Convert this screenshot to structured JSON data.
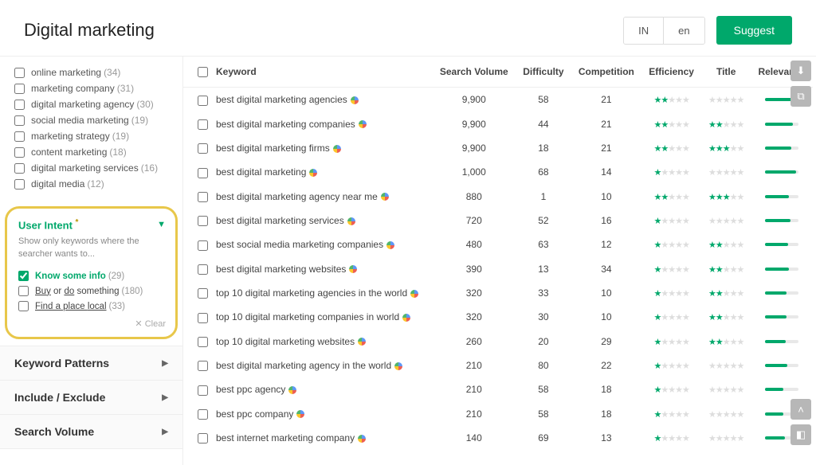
{
  "header": {
    "title": "Digital marketing",
    "country": "IN",
    "lang": "en",
    "suggest": "Suggest"
  },
  "sidebar": {
    "filters": [
      {
        "label": "online marketing",
        "count": 34
      },
      {
        "label": "marketing company",
        "count": 31
      },
      {
        "label": "digital marketing agency",
        "count": 30
      },
      {
        "label": "social media marketing",
        "count": 19
      },
      {
        "label": "marketing strategy",
        "count": 19
      },
      {
        "label": "content marketing",
        "count": 18
      },
      {
        "label": "digital marketing services",
        "count": 16
      },
      {
        "label": "digital media",
        "count": 12
      }
    ],
    "intent": {
      "title": "User Intent",
      "description": "Show only keywords where the searcher wants to...",
      "options": [
        {
          "label": "Know some info",
          "count": 29,
          "checked": true,
          "highlight": true
        },
        {
          "label_pre": "Buy",
          "label_mid": " or ",
          "label_u": "do",
          "label_post": " something",
          "count": 180,
          "checked": false
        },
        {
          "label_pre": "Find a place ",
          "label_u": "local",
          "count": 33,
          "checked": false
        }
      ],
      "clear": "Clear"
    },
    "accordions": [
      "Keyword Patterns",
      "Include / Exclude",
      "Search Volume"
    ]
  },
  "table": {
    "headers": {
      "keyword": "Keyword",
      "volume": "Search Volume",
      "difficulty": "Difficulty",
      "competition": "Competition",
      "efficiency": "Efficiency",
      "title": "Title",
      "relevance": "Relevance"
    },
    "rows": [
      {
        "kw": "best digital marketing agencies",
        "vol": "9,900",
        "diff": 58,
        "comp": 21,
        "eff": 2,
        "ttl": 0,
        "rel": 85
      },
      {
        "kw": "best digital marketing companies",
        "vol": "9,900",
        "diff": 44,
        "comp": 21,
        "eff": 2,
        "ttl": 2,
        "rel": 82
      },
      {
        "kw": "best digital marketing firms",
        "vol": "9,900",
        "diff": 18,
        "comp": 21,
        "eff": 2,
        "ttl": 3,
        "rel": 78
      },
      {
        "kw": "best digital marketing",
        "vol": "1,000",
        "diff": 68,
        "comp": 14,
        "eff": 1,
        "ttl": 0,
        "rel": 92
      },
      {
        "kw": "best digital marketing agency near me",
        "vol": "880",
        "diff": 1,
        "comp": 10,
        "eff": 2,
        "ttl": 3,
        "rel": 70
      },
      {
        "kw": "best digital marketing services",
        "vol": "720",
        "diff": 52,
        "comp": 16,
        "eff": 1,
        "ttl": 0,
        "rel": 75
      },
      {
        "kw": "best social media marketing companies",
        "vol": "480",
        "diff": 63,
        "comp": 12,
        "eff": 1,
        "ttl": 2,
        "rel": 68
      },
      {
        "kw": "best digital marketing websites",
        "vol": "390",
        "diff": 13,
        "comp": 34,
        "eff": 1,
        "ttl": 2,
        "rel": 72
      },
      {
        "kw": "top 10 digital marketing agencies in the world",
        "vol": "320",
        "diff": 33,
        "comp": 10,
        "eff": 1,
        "ttl": 2,
        "rel": 65
      },
      {
        "kw": "top 10 digital marketing companies in world",
        "vol": "320",
        "diff": 30,
        "comp": 10,
        "eff": 1,
        "ttl": 2,
        "rel": 64
      },
      {
        "kw": "top 10 digital marketing websites",
        "vol": "260",
        "diff": 20,
        "comp": 29,
        "eff": 1,
        "ttl": 2,
        "rel": 62
      },
      {
        "kw": "best digital marketing agency in the world",
        "vol": "210",
        "diff": 80,
        "comp": 22,
        "eff": 1,
        "ttl": 0,
        "rel": 66
      },
      {
        "kw": "best ppc agency",
        "vol": "210",
        "diff": 58,
        "comp": 18,
        "eff": 1,
        "ttl": 0,
        "rel": 55
      },
      {
        "kw": "best ppc company",
        "vol": "210",
        "diff": 58,
        "comp": 18,
        "eff": 1,
        "ttl": 0,
        "rel": 54
      },
      {
        "kw": "best internet marketing company",
        "vol": "140",
        "diff": 69,
        "comp": 13,
        "eff": 1,
        "ttl": 0,
        "rel": 58
      }
    ]
  }
}
